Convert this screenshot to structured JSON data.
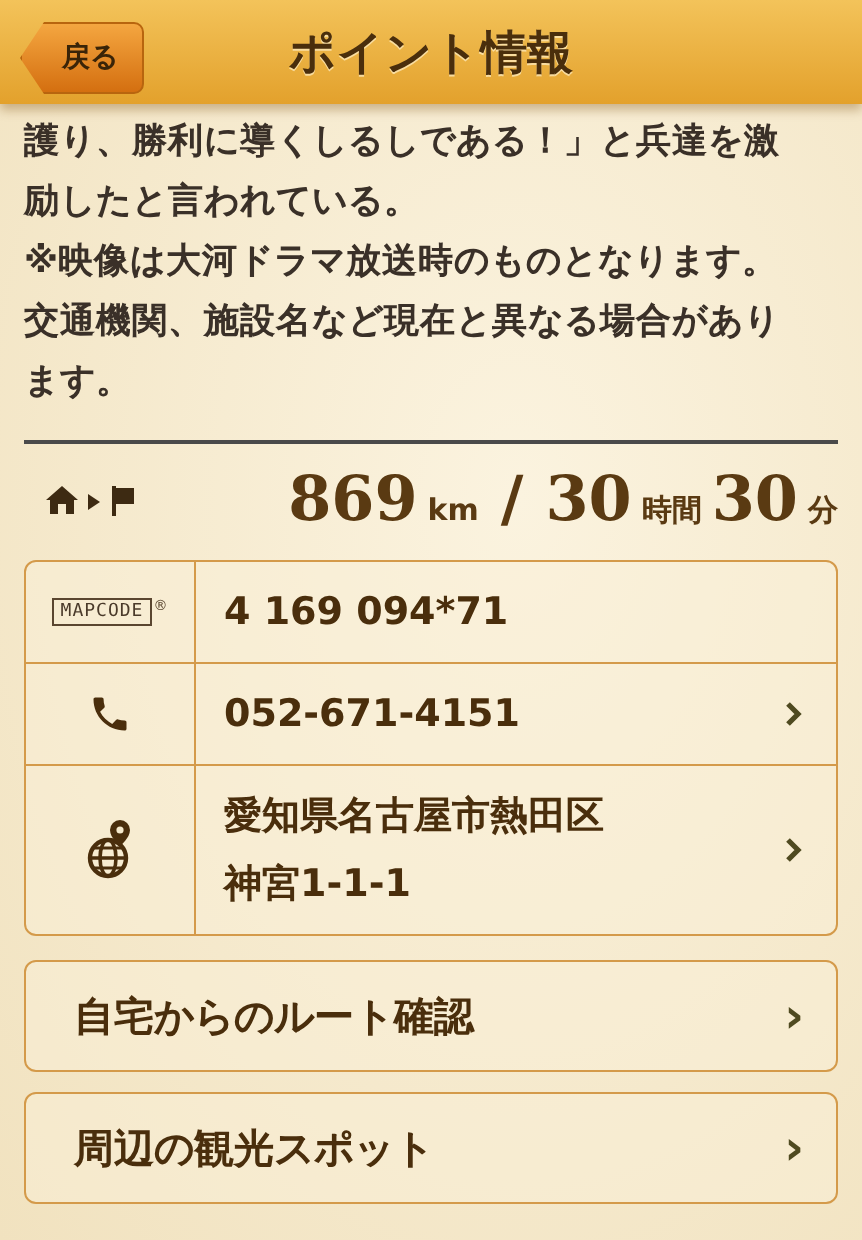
{
  "header": {
    "back_button": "戻る",
    "title": "ポイント情報"
  },
  "description_lines": [
    "護り、勝利に導くしるしである！」と兵達を激",
    "励したと言われている。",
    "※映像は大河ドラマ放送時のものとなります。",
    "交通機関、施設名など現在と異なる場合があり",
    "ます。"
  ],
  "distance": {
    "value": "869",
    "unit": "km",
    "separator": "/",
    "hours": "30",
    "hours_unit": "時間",
    "minutes": "30",
    "minutes_unit": "分"
  },
  "info_rows": [
    {
      "kind": "mapcode",
      "logo": "MAPCODE",
      "mark": "®",
      "lines": [
        "4 169 094*71"
      ],
      "chevron": false
    },
    {
      "kind": "phone",
      "lines": [
        "052-671-4151"
      ],
      "chevron": true
    },
    {
      "kind": "address",
      "lines": [
        "愛知県名古屋市熱田区",
        "神宮1-1-1"
      ],
      "chevron": true
    }
  ],
  "links": [
    {
      "label": "自宅からのルート確認",
      "chevron": "›"
    },
    {
      "label": "周辺の観光スポット",
      "chevron": "›"
    }
  ]
}
